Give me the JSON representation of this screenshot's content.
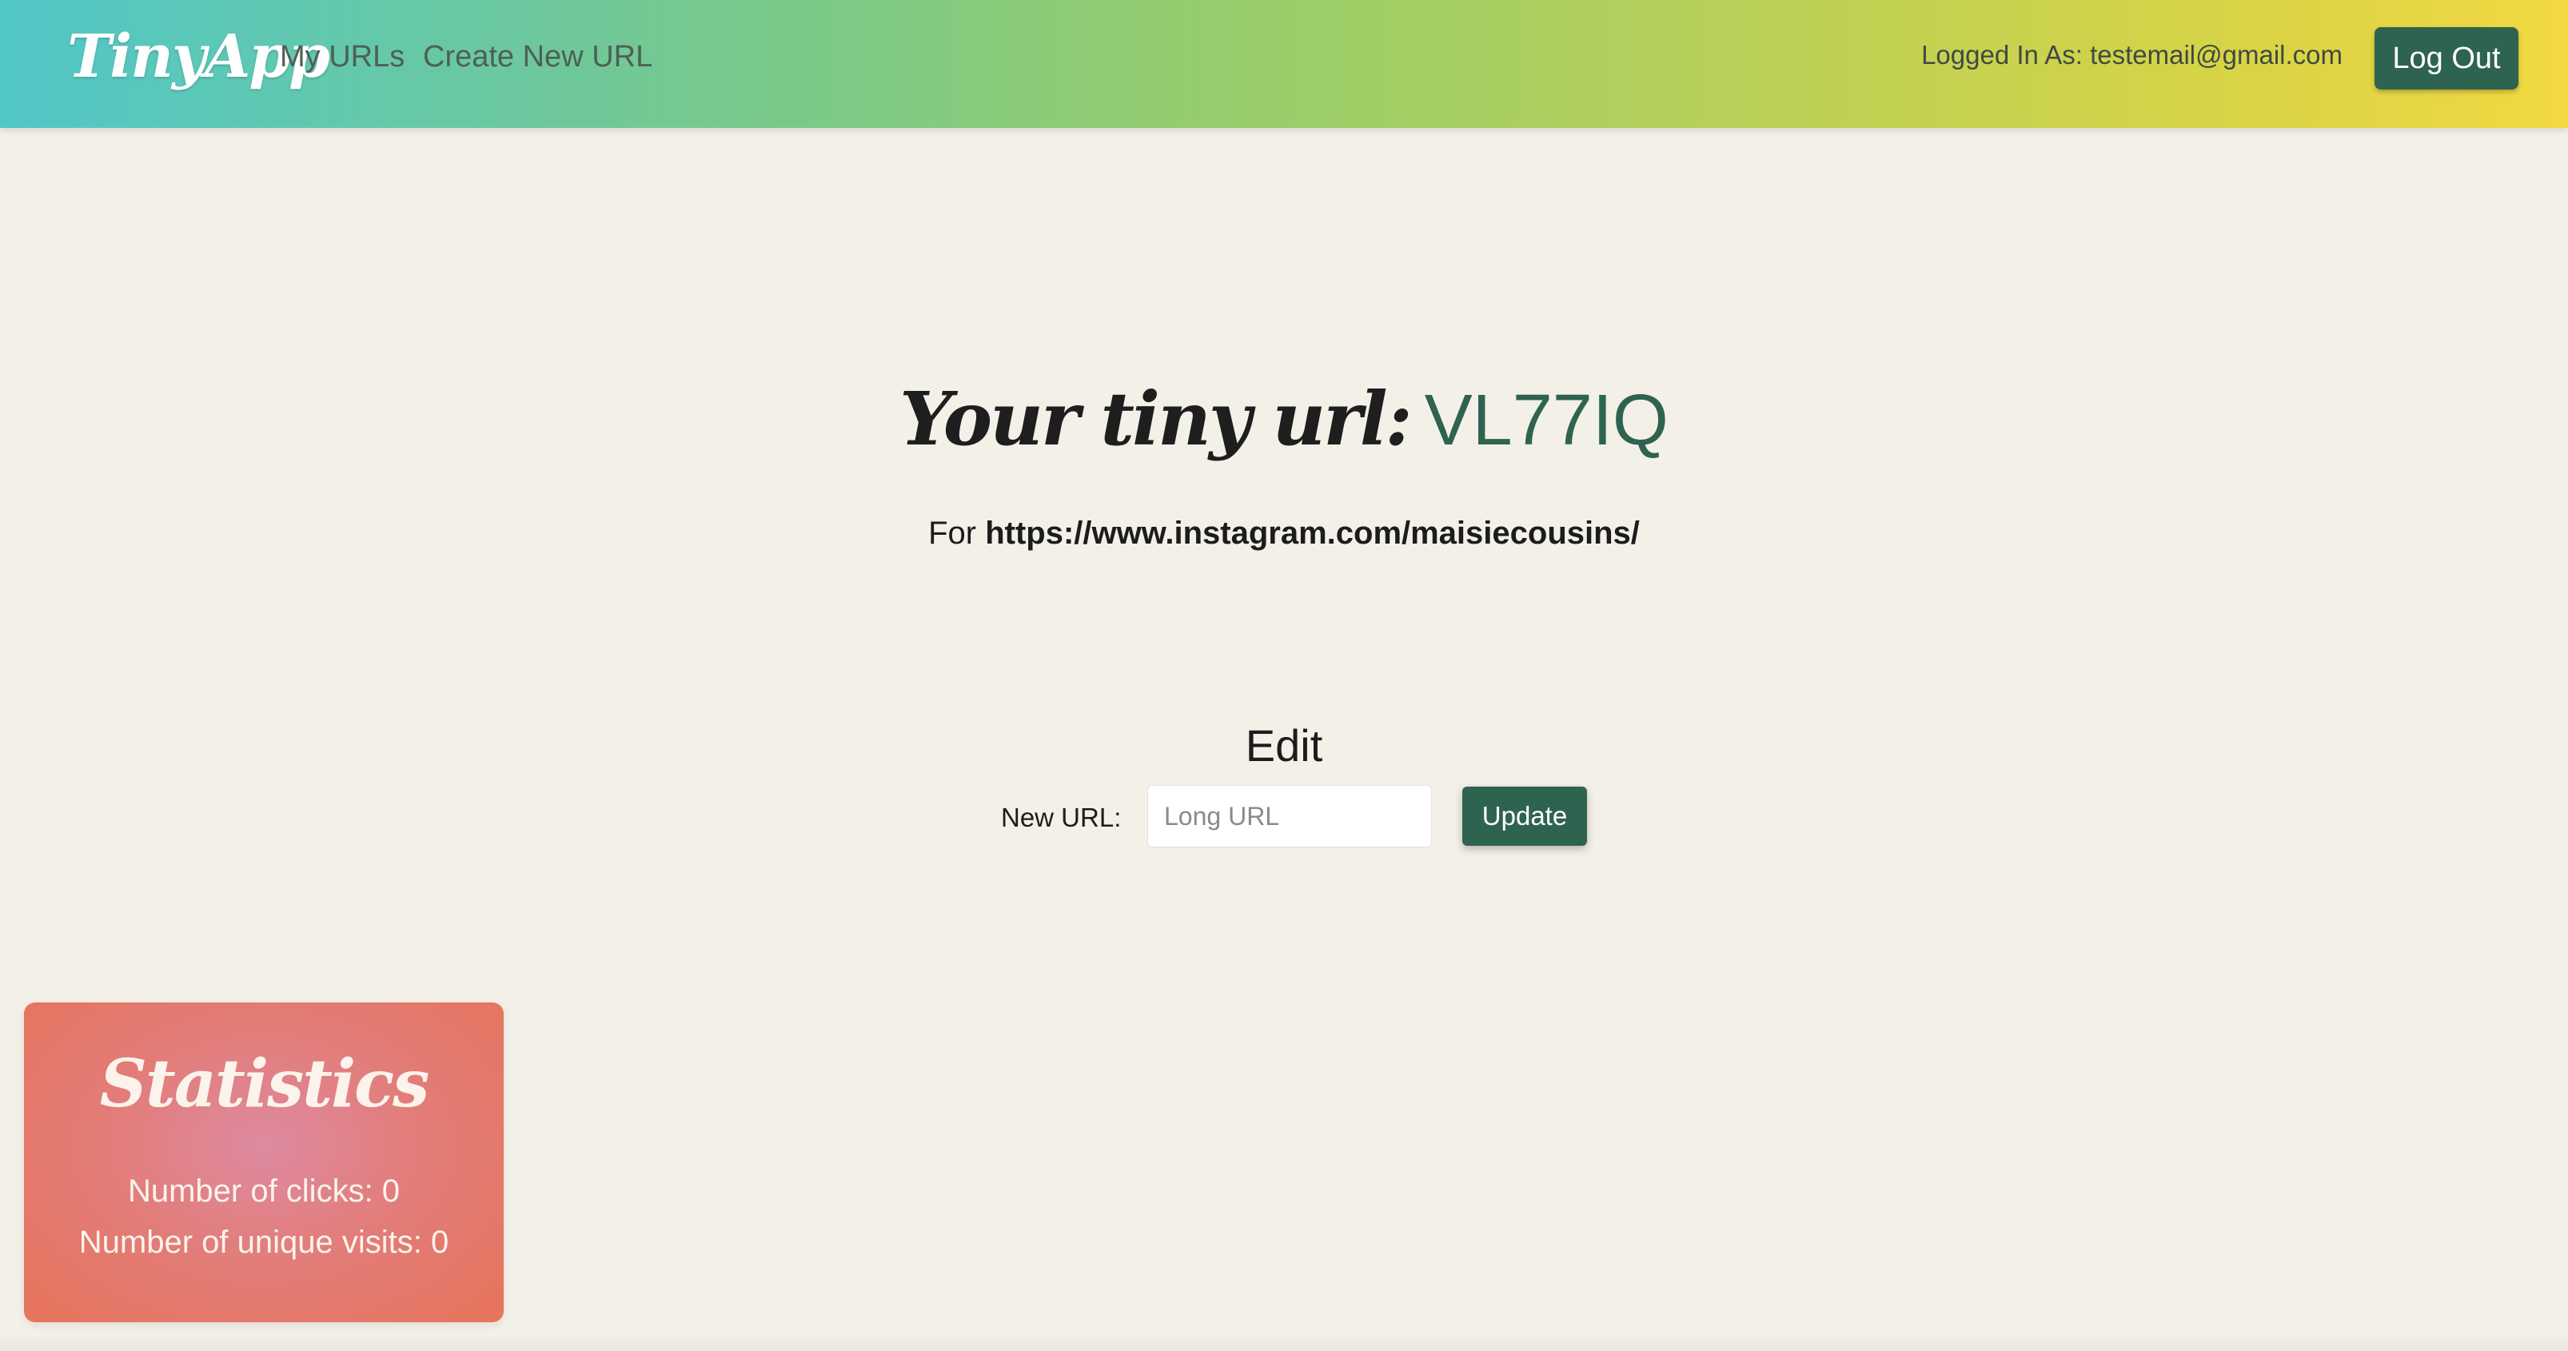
{
  "navbar": {
    "brand": "TinyApp",
    "links": [
      {
        "label": "My URLs"
      },
      {
        "label": "Create New URL"
      }
    ],
    "logged_in_text": "Logged In As: testemail@gmail.com",
    "logout_label": "Log Out",
    "gradient_colors": [
      "#51c7c8",
      "#97cd6b",
      "#f3d842"
    ]
  },
  "main": {
    "heading_prefix": "Your tiny url:",
    "short_code": "VL77IQ",
    "for_prefix": "For",
    "long_url": "https://www.instagram.com/maisiecousins/"
  },
  "edit": {
    "title": "Edit",
    "new_url_label": "New URL:",
    "input_value": "",
    "input_placeholder": "Long URL",
    "update_label": "Update"
  },
  "statistics": {
    "title": "Statistics",
    "clicks_text": "Number of clicks: 0",
    "unique_visits_text": "Number of unique visits: 0"
  },
  "colors": {
    "accent": "#2e6350",
    "page_background": "#f3f0e8",
    "stats_card": "#e7735a"
  }
}
